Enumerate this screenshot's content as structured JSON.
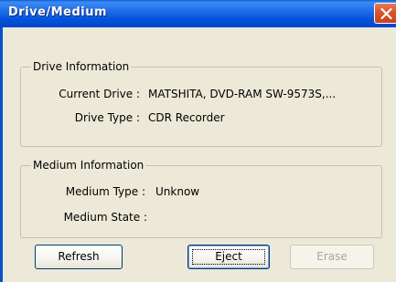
{
  "window": {
    "title": "Drive/Medium"
  },
  "drive_info": {
    "legend": "Drive Information",
    "current_drive_label": "Current Drive :",
    "current_drive_value": "MATSHITA, DVD-RAM SW-9573S,...",
    "drive_type_label": "Drive Type :",
    "drive_type_value": "CDR Recorder"
  },
  "medium_info": {
    "legend": "Medium Information",
    "medium_type_label": "Medium Type :",
    "medium_type_value": "Unknow",
    "medium_state_label": "Medium State :",
    "medium_state_value": ""
  },
  "buttons": {
    "refresh": "Refresh",
    "eject": "Eject",
    "erase": "Erase"
  },
  "colors": {
    "titlebar": "#0553db",
    "window_bg": "#ece9d8",
    "close_button": "#d9532a",
    "disabled_text": "#aca899"
  },
  "icons": {
    "close": "close-x-icon"
  }
}
